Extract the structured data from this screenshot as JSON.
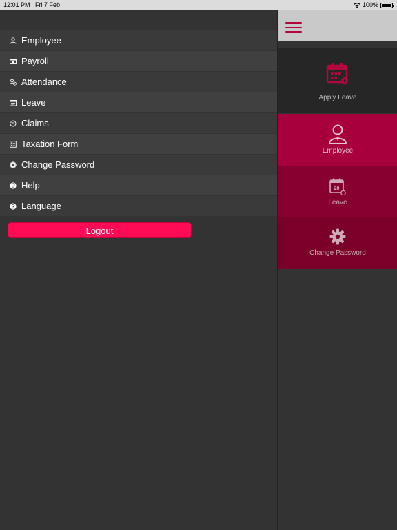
{
  "status_bar": {
    "time": "12:01 PM",
    "date": "Fri 7 Feb",
    "battery": "100%",
    "battery_level": 1.0,
    "wifi_icon": "wifi-icon",
    "battery_icon": "battery-icon"
  },
  "menu": {
    "items": [
      {
        "label": "Employee",
        "icon": "user-icon"
      },
      {
        "label": "Payroll",
        "icon": "payroll-icon"
      },
      {
        "label": "Attendance",
        "icon": "attendance-icon"
      },
      {
        "label": "Leave",
        "icon": "leave-icon"
      },
      {
        "label": "Claims",
        "icon": "history-icon"
      },
      {
        "label": "Taxation Form",
        "icon": "form-icon"
      },
      {
        "label": "Change Password",
        "icon": "gear-icon"
      },
      {
        "label": "Help",
        "icon": "help-icon"
      },
      {
        "label": "Language",
        "icon": "help-icon"
      }
    ],
    "logout_label": "Logout"
  },
  "dashboard": {
    "menu_icon": "hamburger-icon",
    "tiles": [
      {
        "label": "Apply Leave",
        "icon": "calendar-icon"
      },
      {
        "label": "Employee",
        "icon": "user-icon"
      },
      {
        "label": "Leave",
        "icon": "calendar-icon",
        "date_number": "28"
      },
      {
        "label": "Change Password",
        "icon": "gear-icon"
      }
    ]
  },
  "colors": {
    "accent": "#ff0a54",
    "brand_dark": "#a8003c",
    "menu_bg": "#333333"
  }
}
